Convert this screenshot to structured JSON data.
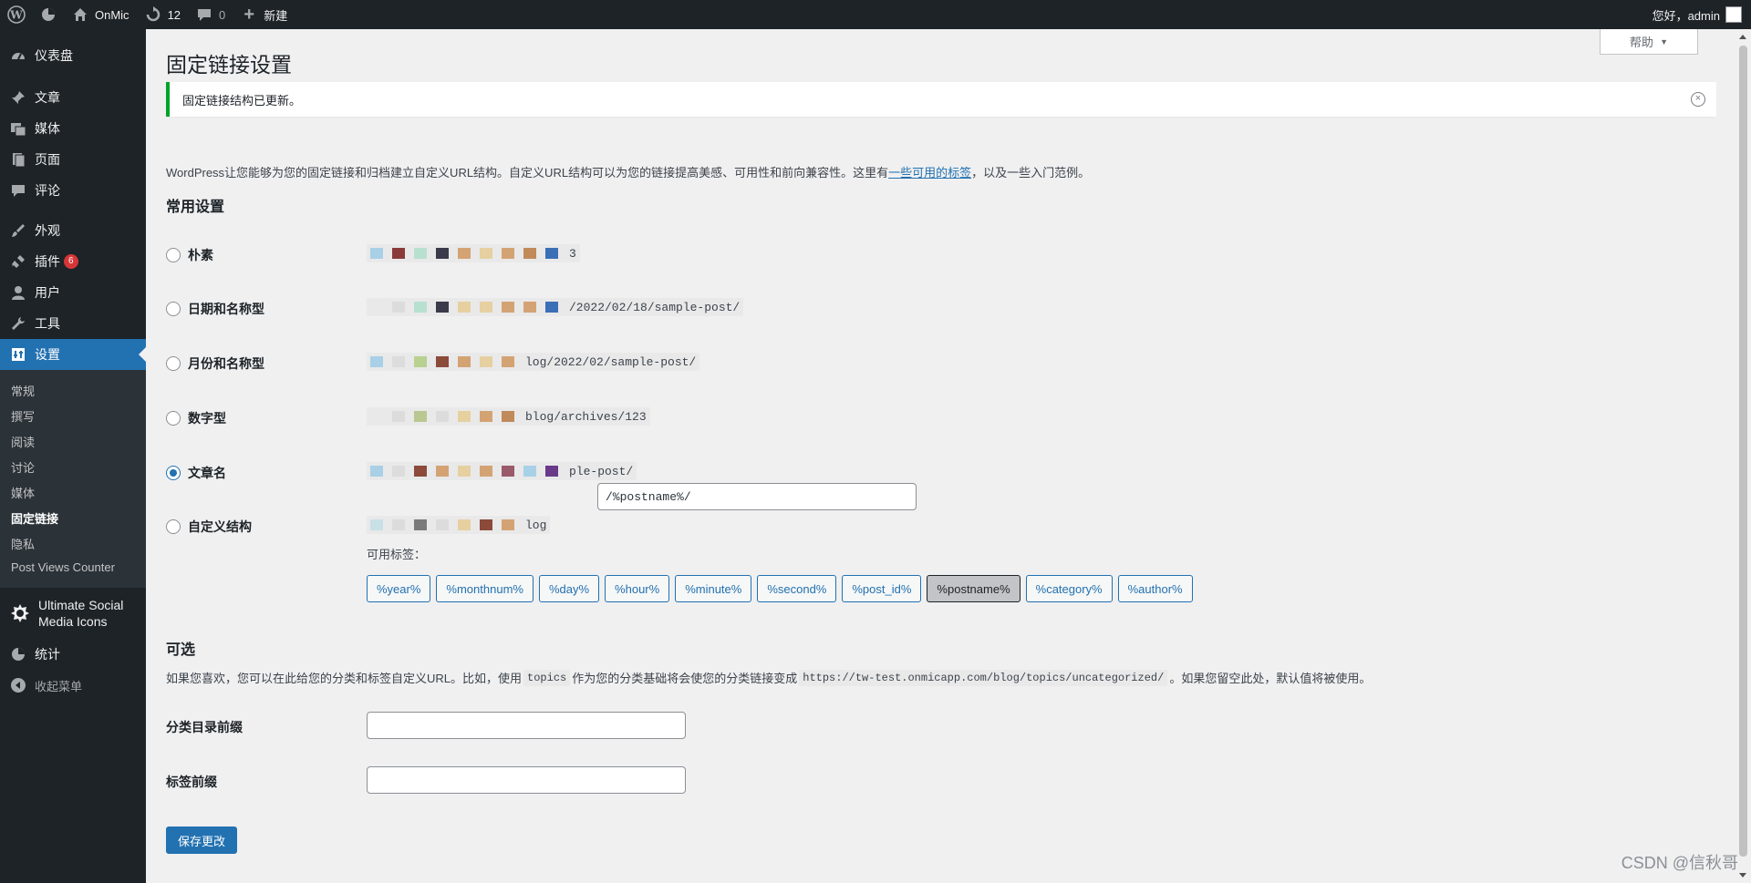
{
  "adminbar": {
    "site_name": "OnMic",
    "updates_count": "12",
    "comments_count": "0",
    "new_label": "新建",
    "greeting": "您好，admin"
  },
  "sidebar": {
    "items": [
      {
        "label": "仪表盘",
        "icon": "dashboard-icon"
      },
      {
        "label": "文章",
        "icon": "pin-icon"
      },
      {
        "label": "媒体",
        "icon": "media-icon"
      },
      {
        "label": "页面",
        "icon": "page-icon"
      },
      {
        "label": "评论",
        "icon": "comment-icon"
      },
      {
        "label": "外观",
        "icon": "brush-icon"
      },
      {
        "label": "插件",
        "icon": "plugin-icon",
        "badge": "6"
      },
      {
        "label": "用户",
        "icon": "user-icon"
      },
      {
        "label": "工具",
        "icon": "wrench-icon"
      },
      {
        "label": "设置",
        "icon": "settings-icon"
      }
    ],
    "submenu": [
      "常规",
      "撰写",
      "阅读",
      "讨论",
      "媒体",
      "固定链接",
      "隐私",
      "Post Views Counter"
    ],
    "usmi_label_1": "Ultimate Social",
    "usmi_label_2": "Media Icons",
    "stats_label": "统计",
    "collapse_label": "收起菜单"
  },
  "header": {
    "help_label": "帮助",
    "title": "固定链接设置"
  },
  "notice": {
    "text": "固定链接结构已更新。"
  },
  "intro": {
    "before": "WordPress让您能够为您的固定链接和归档建立自定义URL结构。自定义URL结构可以为您的链接提高美感、可用性和前向兼容性。这里有",
    "link": "一些可用的标签",
    "after": "，以及一些入门范例。"
  },
  "common": {
    "heading": "常用设置",
    "options": [
      {
        "label": "朴素",
        "sample_suffix": "3",
        "checked": false
      },
      {
        "label": "日期和名称型",
        "sample_suffix": "/2022/02/18/sample-post/",
        "checked": false
      },
      {
        "label": "月份和名称型",
        "sample_suffix": "log/2022/02/sample-post/",
        "checked": false
      },
      {
        "label": "数字型",
        "sample_suffix": "blog/archives/123",
        "checked": false
      },
      {
        "label": "文章名",
        "sample_suffix": "ple-post/",
        "checked": true
      },
      {
        "label": "自定义结构",
        "sample_suffix": "log",
        "checked": false
      }
    ],
    "custom_value": "/%postname%/",
    "available_tags_label": "可用标签：",
    "tags": [
      "%year%",
      "%monthnum%",
      "%day%",
      "%hour%",
      "%minute%",
      "%second%",
      "%post_id%",
      "%postname%",
      "%category%",
      "%author%"
    ],
    "active_tag": "%postname%"
  },
  "optional": {
    "heading": "可选",
    "desc_1": "如果您喜欢，您可以在此给您的分类和标签自定义URL。比如，使用",
    "code_1": "topics",
    "desc_2": "作为您的分类基础将会使您的分类链接变成",
    "code_2": "https://tw-test.onmicapp.com/blog/topics/uncategorized/",
    "desc_3": "。如果您留空此处，默认值将被使用。",
    "category_label": "分类目录前缀",
    "tag_label": "标签前缀"
  },
  "save_label": "保存更改",
  "watermark": "CSDN @信秋哥"
}
